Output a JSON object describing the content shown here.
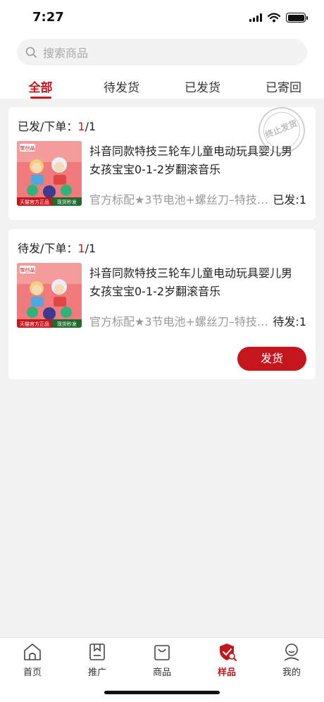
{
  "status_bar": {
    "time": "7:27"
  },
  "search": {
    "placeholder": "搜索商品"
  },
  "tabs": [
    {
      "label": "全部",
      "active": true
    },
    {
      "label": "待发货",
      "active": false
    },
    {
      "label": "已发货",
      "active": false
    },
    {
      "label": "已寄回",
      "active": false
    }
  ],
  "orders": [
    {
      "head_label": "已发/下单：",
      "sent": "1",
      "slash_total": "/1",
      "stamp_text": "终止发货",
      "product": {
        "title": "抖音同款特技三轮车儿童电动玩具婴儿男女孩宝宝0-1-2岁翻滚音乐",
        "spec": "官方标配★3节电池+螺丝刀–特技…",
        "qty_label": "已发:1",
        "thumb_badge_top": "聚创品",
        "thumb_badge_left": "天猫官方正品",
        "thumb_badge_right": "现货秒发"
      }
    },
    {
      "head_label": "待发/下单：",
      "sent": "1",
      "slash_total": "/1",
      "action_label": "发货",
      "product": {
        "title": "抖音同款特技三轮车儿童电动玩具婴儿男女孩宝宝0-1-2岁翻滚音乐",
        "spec": "官方标配★3节电池+螺丝刀–特技…",
        "qty_label": "待发:1",
        "thumb_badge_top": "聚创品",
        "thumb_badge_left": "天猫官方正品",
        "thumb_badge_right": "现货秒发"
      }
    }
  ],
  "tabbar": [
    {
      "label": "首页",
      "icon": "home-icon",
      "active": false
    },
    {
      "label": "推广",
      "icon": "bookmark-icon",
      "active": false
    },
    {
      "label": "商品",
      "icon": "bag-icon",
      "active": false
    },
    {
      "label": "样品",
      "icon": "shield-search-icon",
      "active": true
    },
    {
      "label": "我的",
      "icon": "person-icon",
      "active": false
    }
  ],
  "colors": {
    "accent": "#c5161e",
    "background": "#f2f2f2"
  }
}
